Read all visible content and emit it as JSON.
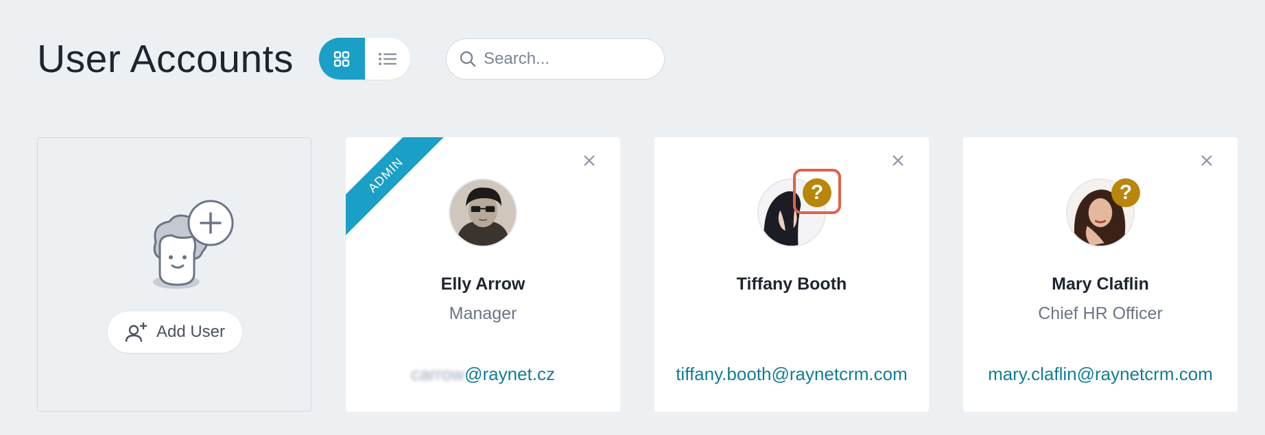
{
  "page_title": "User Accounts",
  "view_toggle": {
    "grid": "grid-view-icon",
    "list": "list-view-icon",
    "active": "grid"
  },
  "search": {
    "placeholder": "Search...",
    "value": ""
  },
  "add_card": {
    "button_label": "Add User"
  },
  "users": [
    {
      "name": "Elly Arrow",
      "role": "Manager",
      "email_hidden": "carrow",
      "email_domain": "@raynet.cz",
      "ribbon": "ADMIN"
    },
    {
      "name": "Tiffany Booth",
      "role": "",
      "email": "tiffany.booth@raynetcrm.com",
      "badge": "?"
    },
    {
      "name": "Mary Claflin",
      "role": "Chief HR Officer",
      "email": "mary.claflin@raynetcrm.com",
      "badge": "?"
    }
  ],
  "colors": {
    "accent": "#1a9fc6",
    "badge": "#b8860b",
    "highlight": "#e0614c",
    "link": "#127c94"
  }
}
